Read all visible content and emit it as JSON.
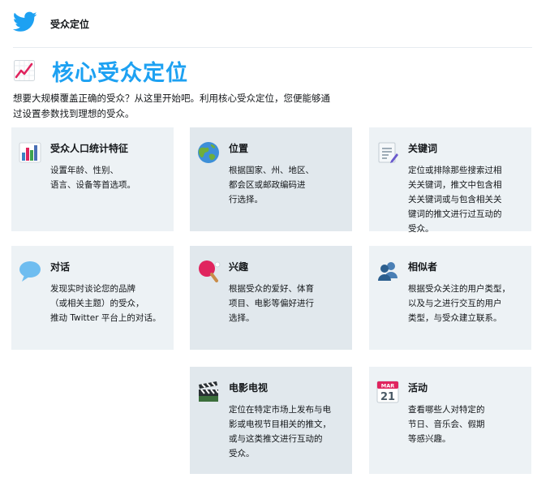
{
  "header": {
    "title": "受众定位",
    "logo_icon": "twitter-bird-icon"
  },
  "hero": {
    "title": "核心受众定位",
    "icon": "trending-chart-icon",
    "intro_line1": "想要大规模覆盖正确的受众？从这里开始吧。利用核心受众定位，您便能够通",
    "intro_line2": "过设置参数找到理想的受众。"
  },
  "cards": [
    {
      "title": "受众人口统计特征",
      "icon": "bar-chart-icon",
      "lines": [
        "设置年龄、性别、",
        "语言、设备等首选项。"
      ]
    },
    {
      "title": "位置",
      "icon": "globe-icon",
      "lines": [
        "根据国家、州、地区、",
        "都会区或邮政编码进",
        "行选择。"
      ]
    },
    {
      "title": "关键词",
      "icon": "document-pencil-icon",
      "lines": [
        "定位或排除那些搜索过相",
        "关关键词，推文中包含相",
        "关关键词或与包含相关关",
        "键词的推文进行过互动的",
        "受众。"
      ]
    },
    {
      "title": "对话",
      "icon": "speech-bubble-icon",
      "lines": [
        "发现实时谈论您的品牌",
        "（或相关主题）的受众，",
        "推动 Twitter 平台上的对话。"
      ]
    },
    {
      "title": "兴趣",
      "icon": "ping-pong-icon",
      "lines": [
        "根据受众的爱好、体育",
        "项目、电影等偏好进行",
        "选择。"
      ]
    },
    {
      "title": "相似者",
      "icon": "users-icon",
      "lines": [
        "根据受众关注的用户类型，",
        "以及与之进行交互的用户",
        "类型，与受众建立联系。"
      ]
    },
    {
      "title": "电影电视",
      "icon": "clapperboard-icon",
      "lines": [
        "定位在特定市场上发布与电",
        "影或电视节目相关的推文，",
        "或与这类推文进行互动的",
        "受众。"
      ]
    },
    {
      "title": "活动",
      "icon": "calendar-icon",
      "calendar_month": "MAR",
      "calendar_day": "21",
      "lines": [
        "查看哪些人对特定的",
        "节日、音乐会、假期",
        "等感兴趣。"
      ]
    }
  ]
}
